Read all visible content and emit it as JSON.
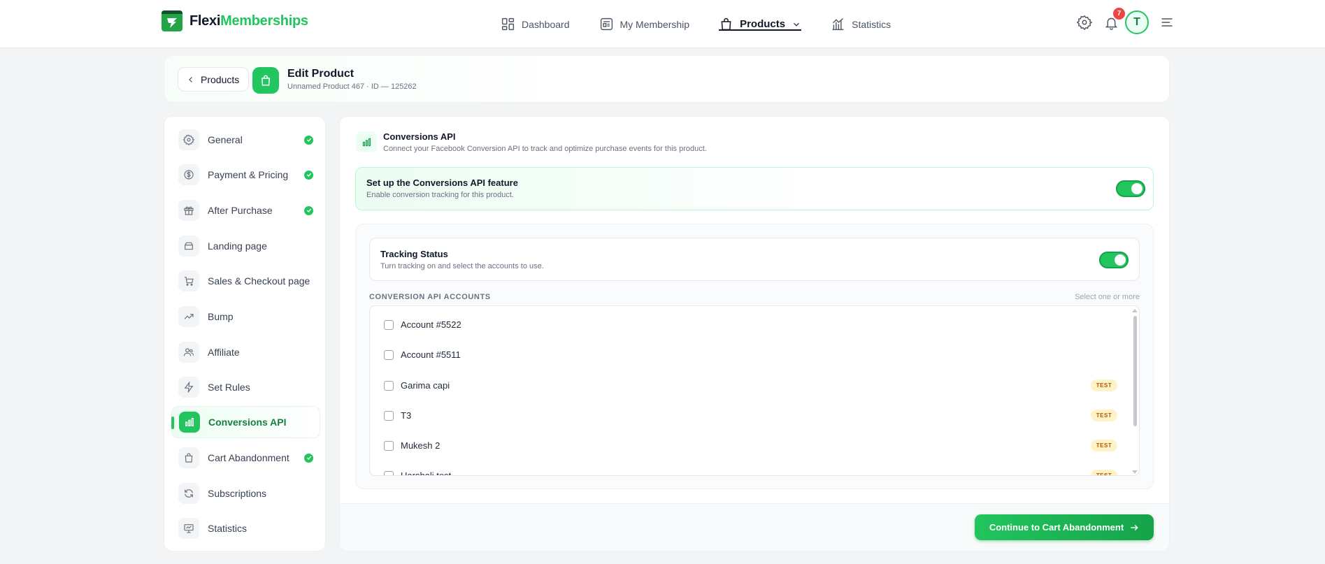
{
  "brand": {
    "name_part1": "Flexi",
    "name_part2": "Memberships",
    "icon": "brand-logo-icon"
  },
  "nav": {
    "items": [
      {
        "label": "Dashboard",
        "icon": "grid-icon",
        "active": false
      },
      {
        "label": "My Membership",
        "icon": "newspaper-icon",
        "active": false
      },
      {
        "label": "Products",
        "icon": "shopping-bag-icon",
        "active": true
      },
      {
        "label": "Statistics",
        "icon": "bar-chart-icon",
        "active": false
      }
    ],
    "notifications_count": "7",
    "avatar_initial": "T"
  },
  "header": {
    "back_label": "Products",
    "title": "Edit Product",
    "subtitle": "Unnamed Product 467 · ID — 125262"
  },
  "sidebar": {
    "items": [
      {
        "label": "General",
        "icon": "gear-icon",
        "complete": true
      },
      {
        "label": "Payment & Pricing",
        "icon": "dollar-icon",
        "complete": true
      },
      {
        "label": "After Purchase",
        "icon": "gift-icon",
        "complete": true
      },
      {
        "label": "Landing page",
        "icon": "inbox-icon",
        "complete": false
      },
      {
        "label": "Sales & Checkout page",
        "icon": "cart-icon",
        "complete": false
      },
      {
        "label": "Bump",
        "icon": "trend-up-icon",
        "complete": false
      },
      {
        "label": "Affiliate",
        "icon": "users-icon",
        "complete": false
      },
      {
        "label": "Set Rules",
        "icon": "bolt-icon",
        "complete": false
      },
      {
        "label": "Conversions API",
        "icon": "bar-chart-icon",
        "complete": false,
        "active": true
      },
      {
        "label": "Cart Abandonment",
        "icon": "shopping-bag-icon",
        "complete": true
      },
      {
        "label": "Subscriptions",
        "icon": "refresh-icon",
        "complete": false
      },
      {
        "label": "Statistics",
        "icon": "presentation-icon",
        "complete": false
      }
    ]
  },
  "section": {
    "title": "Conversions API",
    "subtitle": "Connect your Facebook Conversion API to track and optimize purchase events for this product."
  },
  "setup": {
    "title": "Set up the Conversions API feature",
    "subtitle": "Enable conversion tracking for this product.",
    "enabled": true
  },
  "tracking": {
    "title": "Tracking Status",
    "subtitle": "Turn tracking on and select the accounts to use.",
    "enabled": true
  },
  "accounts": {
    "label": "CONVERSION API ACCOUNTS",
    "hint": "Select one or more",
    "items": [
      {
        "name": "Account #5522",
        "test": false,
        "checked": false
      },
      {
        "name": "Account #5511",
        "test": false,
        "checked": false
      },
      {
        "name": "Garima capi",
        "test": true,
        "checked": false
      },
      {
        "name": "T3",
        "test": true,
        "checked": false
      },
      {
        "name": "Mukesh 2",
        "test": true,
        "checked": false
      },
      {
        "name": "Harshali test",
        "test": true,
        "checked": false
      }
    ],
    "test_badge": "TEST"
  },
  "footer": {
    "continue_label": "Continue to Cart Abandonment"
  },
  "colors": {
    "accent": "#22c55e",
    "accent_dark": "#16a34a",
    "badge_red": "#ef4444"
  }
}
